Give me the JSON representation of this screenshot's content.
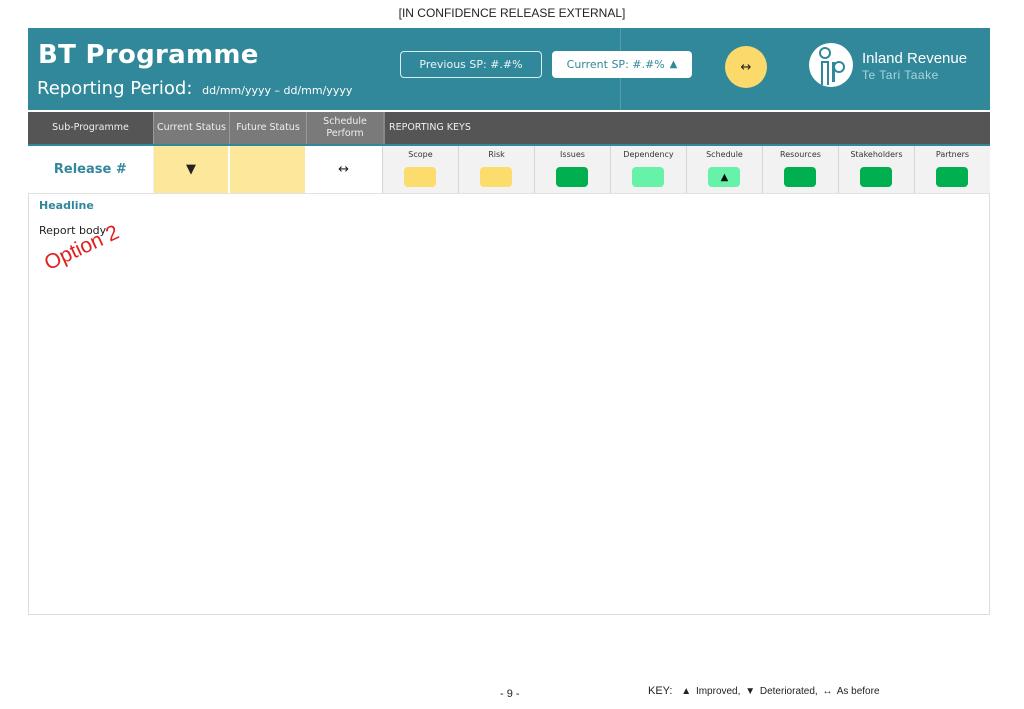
{
  "document": {
    "classification": "[IN CONFIDENCE RELEASE EXTERNAL]",
    "page_number": "- 9 -"
  },
  "header": {
    "title": "BT Programme",
    "period_label": "Reporting Period:",
    "period_dates": "dd/mm/yyyy – dd/mm/yyyy",
    "previous_sp": "Previous SP: #.#%",
    "current_sp": "Current SP: #.#%",
    "current_sp_trend": "▲",
    "overall_trend": "↔",
    "overall_trend_color": "#fbd96a",
    "logo": {
      "icon": "inland-revenue-logo-icon",
      "name": "Inland Revenue",
      "subtitle": "Te Tari Taake"
    },
    "brand_color": "#31889a"
  },
  "table": {
    "headers": {
      "sub_programme": "Sub-Programme",
      "current_status": "Current Status",
      "future_status": "Future Status",
      "schedule_perform": "Schedule Perform",
      "reporting_keys": "REPORTING KEYS"
    },
    "row": {
      "sub_programme": "Release #",
      "current_status": "▼",
      "current_status_color": "#fde79b",
      "future_status": "",
      "future_status_color": "#fde79b",
      "schedule_perform": "↔"
    },
    "keys": [
      {
        "label": "Scope",
        "color": "#fcdc6c",
        "trend": ""
      },
      {
        "label": "Risk",
        "color": "#fcdc6c",
        "trend": ""
      },
      {
        "label": "Issues",
        "color": "#00b050",
        "trend": ""
      },
      {
        "label": "Dependency",
        "color": "#66f2a8",
        "trend": ""
      },
      {
        "label": "Schedule",
        "color": "#66f2a8",
        "trend": "▲"
      },
      {
        "label": "Resources",
        "color": "#00b050",
        "trend": ""
      },
      {
        "label": "Stakeholders",
        "color": "#00b050",
        "trend": ""
      },
      {
        "label": "Partners",
        "color": "#00b050",
        "trend": ""
      }
    ]
  },
  "report": {
    "headline": "Headline",
    "body": "Report body",
    "stamp": "Option 2"
  },
  "legend": {
    "title": "KEY:",
    "items": [
      {
        "glyph": "▲",
        "label": "Improved,"
      },
      {
        "glyph": "▼",
        "label": "Deteriorated,"
      },
      {
        "glyph": "↔",
        "label": "As before"
      }
    ]
  }
}
